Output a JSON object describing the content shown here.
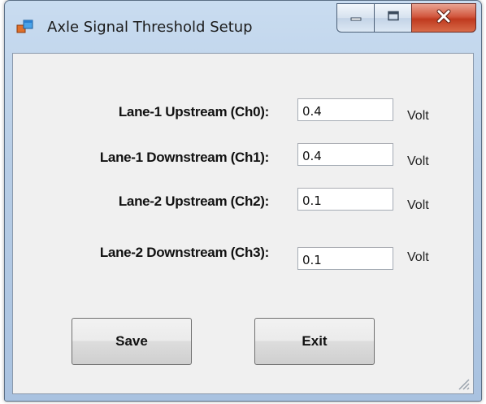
{
  "window": {
    "title": "Axle Signal Threshold Setup",
    "app_icon": "window-app-icon",
    "caption_buttons": [
      "minimize-icon",
      "maximize-icon",
      "close-icon"
    ]
  },
  "form": {
    "rows": [
      {
        "label": "Lane-1 Upstream (Ch0):",
        "value": "0.4",
        "unit": "Volt"
      },
      {
        "label": "Lane-1 Downstream (Ch1):",
        "value": "0.4",
        "unit": "Volt"
      },
      {
        "label": "Lane-2 Upstream (Ch2):",
        "value": "0.1",
        "unit": "Volt"
      },
      {
        "label": "Lane-2 Downstream (Ch3):",
        "value": "0.1",
        "unit": "Volt"
      }
    ]
  },
  "buttons": {
    "save_label": "Save",
    "exit_label": "Exit"
  },
  "colors": {
    "title_bar": "#b9d1ea",
    "client_bg": "#f0f0f0",
    "close_button": "#c9452a"
  }
}
